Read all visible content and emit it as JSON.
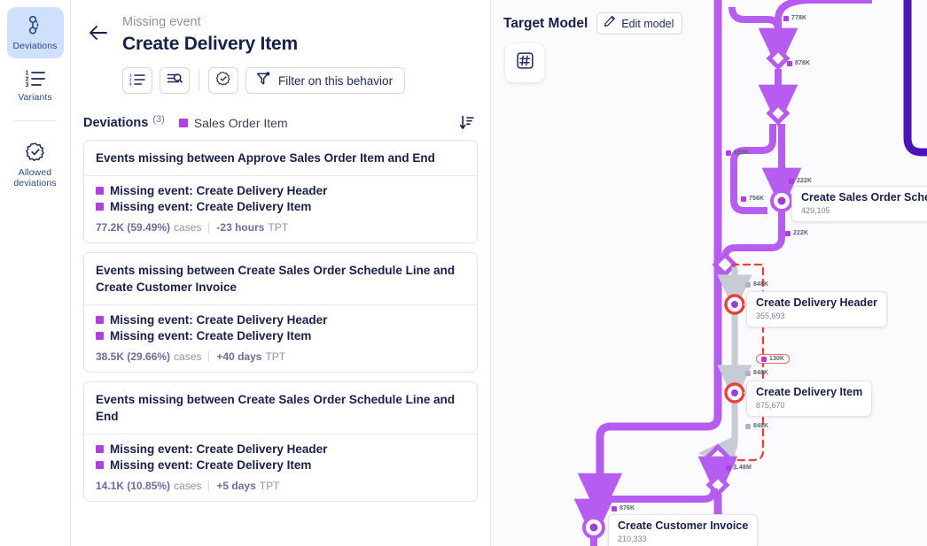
{
  "sidebar": {
    "items": [
      {
        "label": "Deviations",
        "icon": "deviations-icon",
        "active": true
      },
      {
        "label": "Variants",
        "icon": "variants-icon",
        "active": false
      },
      {
        "label": "Allowed\ndeviations",
        "icon": "allowed-deviations-icon",
        "active": false
      }
    ]
  },
  "header": {
    "back_icon": "arrow-left-icon",
    "eyebrow": "Missing event",
    "title": "Create Delivery Item",
    "tools": [
      {
        "name": "ordered-list-button",
        "icon": "ordered-list-icon"
      },
      {
        "name": "inspect-case-button",
        "icon": "case-search-icon"
      },
      {
        "name": "allow-deviation-button",
        "icon": "badge-check-icon"
      }
    ],
    "filter_button": {
      "label": "Filter on this behavior",
      "icon": "filter-icon"
    }
  },
  "deviations": {
    "title": "Deviations",
    "count": "(3)",
    "legend_label": "Sales Order Item",
    "legend_color": "#b23ee0",
    "sort_icon": "sort-descending-icon",
    "cards": [
      {
        "heading": "Events missing between Approve Sales Order Item and End",
        "missing": [
          "Missing event: Create Delivery Header",
          "Missing event: Create Delivery Item"
        ],
        "cases_value": "77.2K (59.49%)",
        "cases_label": "cases",
        "tpt_value": "-23 hours",
        "tpt_label": "TPT"
      },
      {
        "heading": "Events missing between Create Sales Order Schedule Line and Create Customer Invoice",
        "missing": [
          "Missing event: Create Delivery Header",
          "Missing event: Create Delivery Item"
        ],
        "cases_value": "38.5K (29.66%)",
        "cases_label": "cases",
        "tpt_value": "+40 days",
        "tpt_label": "TPT"
      },
      {
        "heading": "Events missing between Create Sales Order Schedule Line and End",
        "missing": [
          "Missing event: Create Delivery Header",
          "Missing event: Create Delivery Item"
        ],
        "cases_value": "14.1K (10.85%)",
        "cases_label": "cases",
        "tpt_value": "+5 days",
        "tpt_label": "TPT"
      }
    ]
  },
  "target_model": {
    "title": "Target Model",
    "edit_button": {
      "label": "Edit model",
      "icon": "pencil-icon"
    },
    "fab": {
      "name": "frequency-button",
      "icon": "hash-icon"
    },
    "nodes": [
      {
        "name": "Create Sales Order Schedule Line",
        "value": "429,105"
      },
      {
        "name": "Create Delivery Header",
        "value": "355,693"
      },
      {
        "name": "Create Delivery Item",
        "value": "875,670"
      },
      {
        "name": "Create Customer Invoice",
        "value": "210,333"
      }
    ],
    "edge_labels": [
      {
        "text": "778K",
        "color": "#b23ee0"
      },
      {
        "text": "878K",
        "color": "#b23ee0"
      },
      {
        "text": "289K",
        "color": "#b23ee0"
      },
      {
        "text": "756K",
        "color": "#b23ee0"
      },
      {
        "text": "222K",
        "color": "#b23ee0"
      },
      {
        "text": "222K",
        "color": "#b23ee0"
      },
      {
        "text": "848K",
        "color": "#b0b4c0"
      },
      {
        "text": "130K",
        "color": "#b23ee0"
      },
      {
        "text": "848K",
        "color": "#b0b4c0"
      },
      {
        "text": "848K",
        "color": "#b0b4c0"
      },
      {
        "text": "1.48M",
        "color": "#b23ee0"
      },
      {
        "text": "876K",
        "color": "#b23ee0"
      }
    ],
    "colors": {
      "flow_purple": "#b65cf0",
      "flow_dark_purple": "#4a14b8",
      "flow_gray": "#c7cbd4",
      "deviation_red": "#e8413c"
    }
  }
}
